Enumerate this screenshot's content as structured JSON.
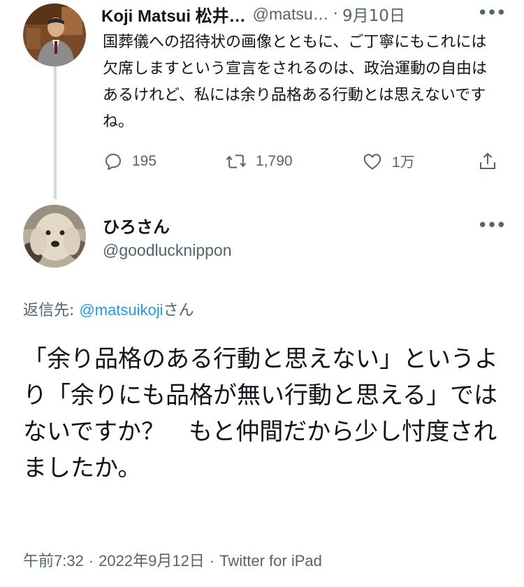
{
  "tweet1": {
    "name": "Koji Matsui 松井…",
    "handle": "@matsu…",
    "separator": "·",
    "date": "9月10日",
    "text": "国葬儀への招待状の画像とともに、ご丁寧にもこれには欠席しますという宣言をされるのは、政治運動の自由はあるけれど、私には余り品格ある行動とは思えないですね。",
    "replies": "195",
    "retweets": "1,790",
    "likes": "1万"
  },
  "tweet2": {
    "name": "ひろさん",
    "handle": "@goodlucknippon",
    "reply_to_label": "返信先:",
    "reply_to_handle": "@matsuikoji",
    "reply_to_suffix": "さん",
    "text": "「余り品格のある行動と思えない」というより「余りにも品格が無い行動と思える」ではないですか？　もと仲間だから少し忖度されましたか。",
    "time": "午前7:32",
    "separator": "·",
    "date": "2022年9月12日",
    "source": "Twitter for iPad"
  },
  "icons": {
    "more": "more-icon",
    "reply": "reply-icon",
    "retweet": "retweet-icon",
    "like": "heart-icon",
    "share": "share-icon"
  },
  "colors": {
    "text": "#0f1419",
    "secondary": "#536471",
    "link": "#1d9bf0",
    "thread_line": "#cfd9de"
  }
}
